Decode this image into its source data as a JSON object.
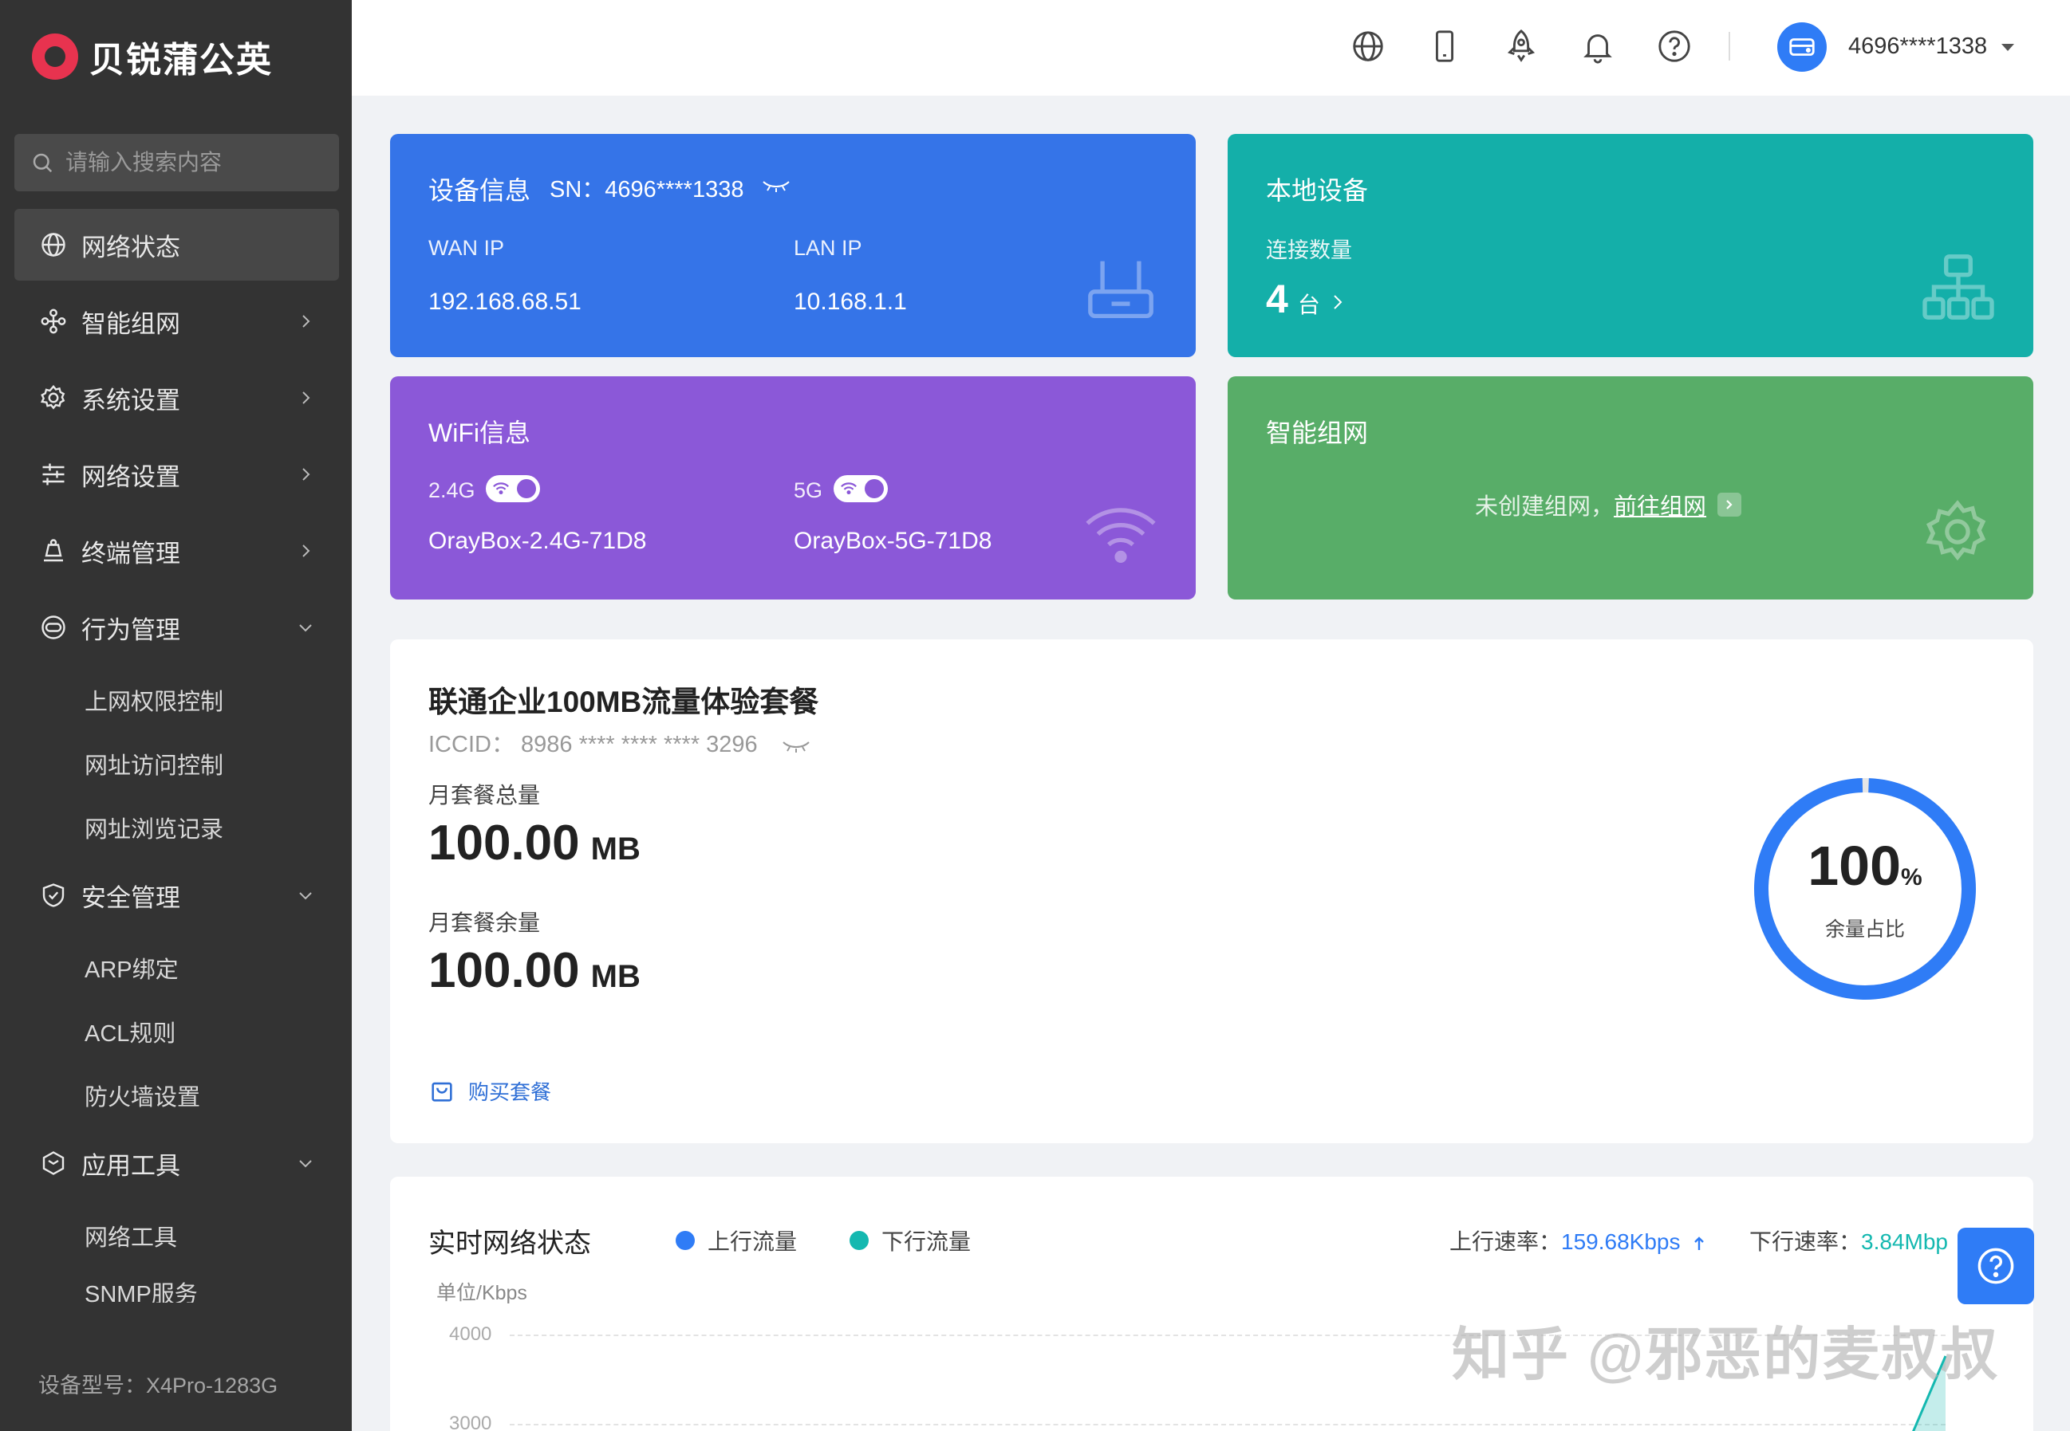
{
  "brand": {
    "name": "贝锐蒲公英"
  },
  "search": {
    "placeholder": "请输入搜索内容"
  },
  "nav": {
    "items": [
      {
        "label": "网络状态"
      },
      {
        "label": "智能组网"
      },
      {
        "label": "系统设置"
      },
      {
        "label": "网络设置"
      },
      {
        "label": "终端管理"
      },
      {
        "label": "行为管理"
      },
      {
        "label": "安全管理"
      },
      {
        "label": "应用工具"
      }
    ],
    "behavior_sub": [
      "上网权限控制",
      "网址访问控制",
      "网址浏览记录"
    ],
    "security_sub": [
      "ARP绑定",
      "ACL规则",
      "防火墙设置"
    ],
    "tools_sub": [
      "网络工具",
      "SNMP服务"
    ]
  },
  "model": "设备型号：X4Pro-1283G",
  "header": {
    "username": "4696****1338"
  },
  "device": {
    "title": "设备信息",
    "sn": "SN：4696****1338",
    "wan_label": "WAN IP",
    "wan_value": "192.168.68.51",
    "lan_label": "LAN IP",
    "lan_value": "10.168.1.1"
  },
  "local": {
    "title": "本地设备",
    "count_label": "连接数量",
    "count": "4",
    "count_unit": "台"
  },
  "wifi": {
    "title": "WiFi信息",
    "band1": "2.4G",
    "ssid1": "OrayBox-2.4G-71D8",
    "band2": "5G",
    "ssid2": "OrayBox-5G-71D8"
  },
  "mesh": {
    "title": "智能组网",
    "empty_text": "未创建组网，",
    "link_text": "前往组网"
  },
  "plan": {
    "title": "联通企业100MB流量体验套餐",
    "iccid": "ICCID：  8986 **** **** **** 3296",
    "total_label": "月套餐总量",
    "total_value": "100.00",
    "total_unit": "MB",
    "remain_label": "月套餐余量",
    "remain_value": "100.00",
    "remain_unit": "MB",
    "buy_label": "购买套餐",
    "ring_value": "100",
    "ring_pct": "%",
    "ring_caption": "余量占比",
    "ring_fraction": 1.0
  },
  "realtime": {
    "title": "实时网络状态",
    "legend_up": "上行流量",
    "legend_down": "下行流量",
    "up_rate_label": "上行速率：",
    "up_rate_value": "159.68Kbps",
    "down_rate_label": "下行速率：",
    "down_rate_value": "3.84Mbp",
    "unit": "单位/Kbps",
    "ticks": [
      "4000",
      "3000"
    ]
  },
  "colors": {
    "sidebar": "#333333",
    "blue_card": "#3574e8",
    "teal_card": "#14afa9",
    "purple_card": "#8b58d8",
    "green_card": "#58ad68",
    "upload": "#2f7cf6",
    "download": "#14b8b0"
  },
  "watermark": "知乎 @邪恶的麦叔叔"
}
